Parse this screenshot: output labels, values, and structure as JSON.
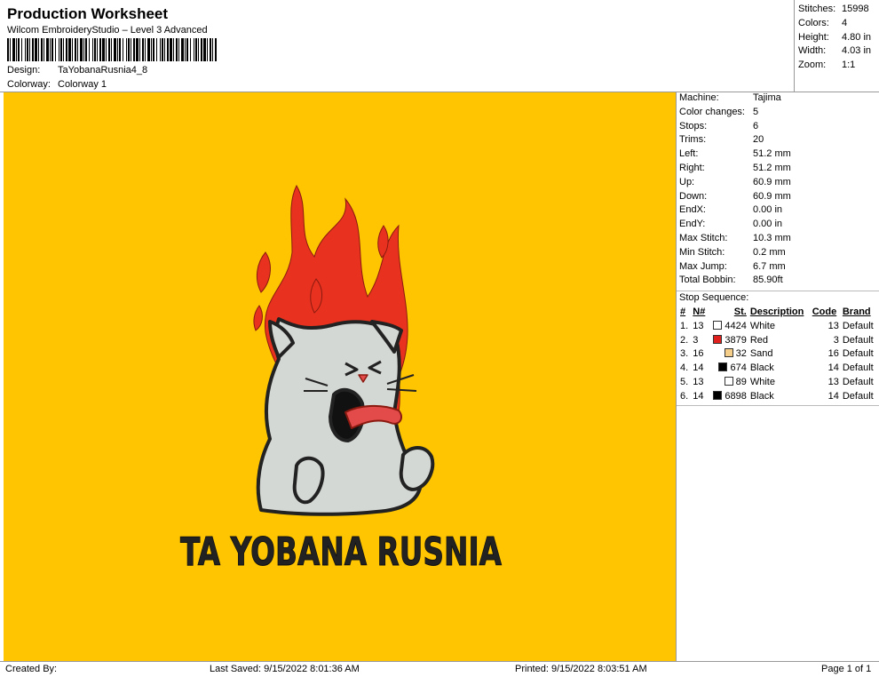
{
  "header": {
    "title": "Production Worksheet",
    "subtitle": "Wilcom EmbroideryStudio – Level 3 Advanced",
    "design_label": "Design:",
    "design_value": "TaYobanaRusnia4_8",
    "colorway_label": "Colorway:",
    "colorway_value": "Colorway 1"
  },
  "stats": [
    {
      "label": "Stitches:",
      "value": "15998"
    },
    {
      "label": "Colors:",
      "value": "4"
    },
    {
      "label": "Height:",
      "value": "4.80 in"
    },
    {
      "label": "Width:",
      "value": "4.03 in"
    },
    {
      "label": "Zoom:",
      "value": "1:1"
    }
  ],
  "machine": [
    {
      "label": "Machine:",
      "value": "Tajima"
    },
    {
      "label": "Color changes:",
      "value": "5"
    },
    {
      "label": "Stops:",
      "value": "6"
    },
    {
      "label": "Trims:",
      "value": "20"
    },
    {
      "label": "Left:",
      "value": "51.2 mm"
    },
    {
      "label": "Right:",
      "value": "51.2 mm"
    },
    {
      "label": "Up:",
      "value": "60.9 mm"
    },
    {
      "label": "Down:",
      "value": "60.9 mm"
    },
    {
      "label": "EndX:",
      "value": "0.00 in"
    },
    {
      "label": "EndY:",
      "value": "0.00 in"
    },
    {
      "label": "Max Stitch:",
      "value": "10.3 mm"
    },
    {
      "label": "Min Stitch:",
      "value": "0.2 mm"
    },
    {
      "label": "Max Jump:",
      "value": "6.7 mm"
    },
    {
      "label": "Total Bobbin:",
      "value": "85.90ft"
    }
  ],
  "stop_sequence": {
    "title": "Stop Sequence:",
    "headers": {
      "num": "#",
      "n": "N#",
      "st": "St.",
      "desc": "Description",
      "code": "Code",
      "brand": "Brand"
    },
    "rows": [
      {
        "num": "1.",
        "n": "13",
        "color": "#ffffff",
        "st": "4424",
        "desc": "White",
        "code": "13",
        "brand": "Default"
      },
      {
        "num": "2.",
        "n": "3",
        "color": "#e0201c",
        "st": "3879",
        "desc": "Red",
        "code": "3",
        "brand": "Default"
      },
      {
        "num": "3.",
        "n": "16",
        "color": "#f5cf8a",
        "st": "32",
        "desc": "Sand",
        "code": "16",
        "brand": "Default"
      },
      {
        "num": "4.",
        "n": "14",
        "color": "#000000",
        "st": "674",
        "desc": "Black",
        "code": "14",
        "brand": "Default"
      },
      {
        "num": "5.",
        "n": "13",
        "color": "#ffffff",
        "st": "89",
        "desc": "White",
        "code": "13",
        "brand": "Default"
      },
      {
        "num": "6.",
        "n": "14",
        "color": "#000000",
        "st": "6898",
        "desc": "Black",
        "code": "14",
        "brand": "Default"
      }
    ]
  },
  "design": {
    "text": "TA YOBANA RUSNIA",
    "background_color": "#ffc500",
    "flame_color": "#e8321f",
    "cat_color": "#d4d8d4",
    "outline_color": "#222222"
  },
  "footer": {
    "created_by": "Created By:",
    "last_saved": "Last Saved: 9/15/2022 8:01:36 AM",
    "printed": "Printed: 9/15/2022 8:03:51 AM",
    "page": "Page 1 of 1"
  }
}
